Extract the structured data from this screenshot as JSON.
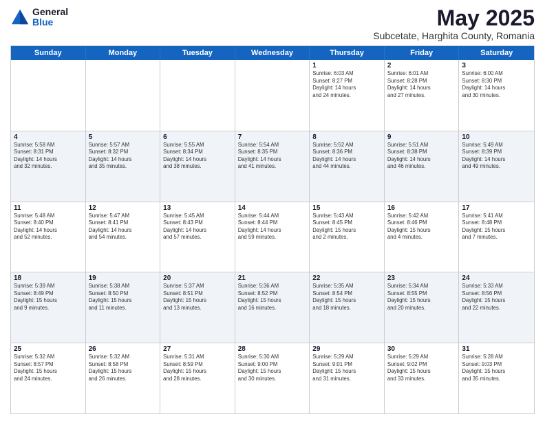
{
  "logo": {
    "general": "General",
    "blue": "Blue"
  },
  "header": {
    "month_year": "May 2025",
    "subtitle": "Subcetate, Harghita County, Romania"
  },
  "weekdays": [
    "Sunday",
    "Monday",
    "Tuesday",
    "Wednesday",
    "Thursday",
    "Friday",
    "Saturday"
  ],
  "rows": [
    {
      "alt": false,
      "cells": [
        {
          "day": "",
          "info": ""
        },
        {
          "day": "",
          "info": ""
        },
        {
          "day": "",
          "info": ""
        },
        {
          "day": "",
          "info": ""
        },
        {
          "day": "1",
          "info": "Sunrise: 6:03 AM\nSunset: 8:27 PM\nDaylight: 14 hours\nand 24 minutes."
        },
        {
          "day": "2",
          "info": "Sunrise: 6:01 AM\nSunset: 8:28 PM\nDaylight: 14 hours\nand 27 minutes."
        },
        {
          "day": "3",
          "info": "Sunrise: 6:00 AM\nSunset: 8:30 PM\nDaylight: 14 hours\nand 30 minutes."
        }
      ]
    },
    {
      "alt": true,
      "cells": [
        {
          "day": "4",
          "info": "Sunrise: 5:58 AM\nSunset: 8:31 PM\nDaylight: 14 hours\nand 32 minutes."
        },
        {
          "day": "5",
          "info": "Sunrise: 5:57 AM\nSunset: 8:32 PM\nDaylight: 14 hours\nand 35 minutes."
        },
        {
          "day": "6",
          "info": "Sunrise: 5:55 AM\nSunset: 8:34 PM\nDaylight: 14 hours\nand 38 minutes."
        },
        {
          "day": "7",
          "info": "Sunrise: 5:54 AM\nSunset: 8:35 PM\nDaylight: 14 hours\nand 41 minutes."
        },
        {
          "day": "8",
          "info": "Sunrise: 5:52 AM\nSunset: 8:36 PM\nDaylight: 14 hours\nand 44 minutes."
        },
        {
          "day": "9",
          "info": "Sunrise: 5:51 AM\nSunset: 8:38 PM\nDaylight: 14 hours\nand 46 minutes."
        },
        {
          "day": "10",
          "info": "Sunrise: 5:49 AM\nSunset: 8:39 PM\nDaylight: 14 hours\nand 49 minutes."
        }
      ]
    },
    {
      "alt": false,
      "cells": [
        {
          "day": "11",
          "info": "Sunrise: 5:48 AM\nSunset: 8:40 PM\nDaylight: 14 hours\nand 52 minutes."
        },
        {
          "day": "12",
          "info": "Sunrise: 5:47 AM\nSunset: 8:41 PM\nDaylight: 14 hours\nand 54 minutes."
        },
        {
          "day": "13",
          "info": "Sunrise: 5:45 AM\nSunset: 8:43 PM\nDaylight: 14 hours\nand 57 minutes."
        },
        {
          "day": "14",
          "info": "Sunrise: 5:44 AM\nSunset: 8:44 PM\nDaylight: 14 hours\nand 59 minutes."
        },
        {
          "day": "15",
          "info": "Sunrise: 5:43 AM\nSunset: 8:45 PM\nDaylight: 15 hours\nand 2 minutes."
        },
        {
          "day": "16",
          "info": "Sunrise: 5:42 AM\nSunset: 8:46 PM\nDaylight: 15 hours\nand 4 minutes."
        },
        {
          "day": "17",
          "info": "Sunrise: 5:41 AM\nSunset: 8:48 PM\nDaylight: 15 hours\nand 7 minutes."
        }
      ]
    },
    {
      "alt": true,
      "cells": [
        {
          "day": "18",
          "info": "Sunrise: 5:39 AM\nSunset: 8:49 PM\nDaylight: 15 hours\nand 9 minutes."
        },
        {
          "day": "19",
          "info": "Sunrise: 5:38 AM\nSunset: 8:50 PM\nDaylight: 15 hours\nand 11 minutes."
        },
        {
          "day": "20",
          "info": "Sunrise: 5:37 AM\nSunset: 8:51 PM\nDaylight: 15 hours\nand 13 minutes."
        },
        {
          "day": "21",
          "info": "Sunrise: 5:36 AM\nSunset: 8:52 PM\nDaylight: 15 hours\nand 16 minutes."
        },
        {
          "day": "22",
          "info": "Sunrise: 5:35 AM\nSunset: 8:54 PM\nDaylight: 15 hours\nand 18 minutes."
        },
        {
          "day": "23",
          "info": "Sunrise: 5:34 AM\nSunset: 8:55 PM\nDaylight: 15 hours\nand 20 minutes."
        },
        {
          "day": "24",
          "info": "Sunrise: 5:33 AM\nSunset: 8:56 PM\nDaylight: 15 hours\nand 22 minutes."
        }
      ]
    },
    {
      "alt": false,
      "cells": [
        {
          "day": "25",
          "info": "Sunrise: 5:32 AM\nSunset: 8:57 PM\nDaylight: 15 hours\nand 24 minutes."
        },
        {
          "day": "26",
          "info": "Sunrise: 5:32 AM\nSunset: 8:58 PM\nDaylight: 15 hours\nand 26 minutes."
        },
        {
          "day": "27",
          "info": "Sunrise: 5:31 AM\nSunset: 8:59 PM\nDaylight: 15 hours\nand 28 minutes."
        },
        {
          "day": "28",
          "info": "Sunrise: 5:30 AM\nSunset: 9:00 PM\nDaylight: 15 hours\nand 30 minutes."
        },
        {
          "day": "29",
          "info": "Sunrise: 5:29 AM\nSunset: 9:01 PM\nDaylight: 15 hours\nand 31 minutes."
        },
        {
          "day": "30",
          "info": "Sunrise: 5:29 AM\nSunset: 9:02 PM\nDaylight: 15 hours\nand 33 minutes."
        },
        {
          "day": "31",
          "info": "Sunrise: 5:28 AM\nSunset: 9:03 PM\nDaylight: 15 hours\nand 35 minutes."
        }
      ]
    }
  ]
}
